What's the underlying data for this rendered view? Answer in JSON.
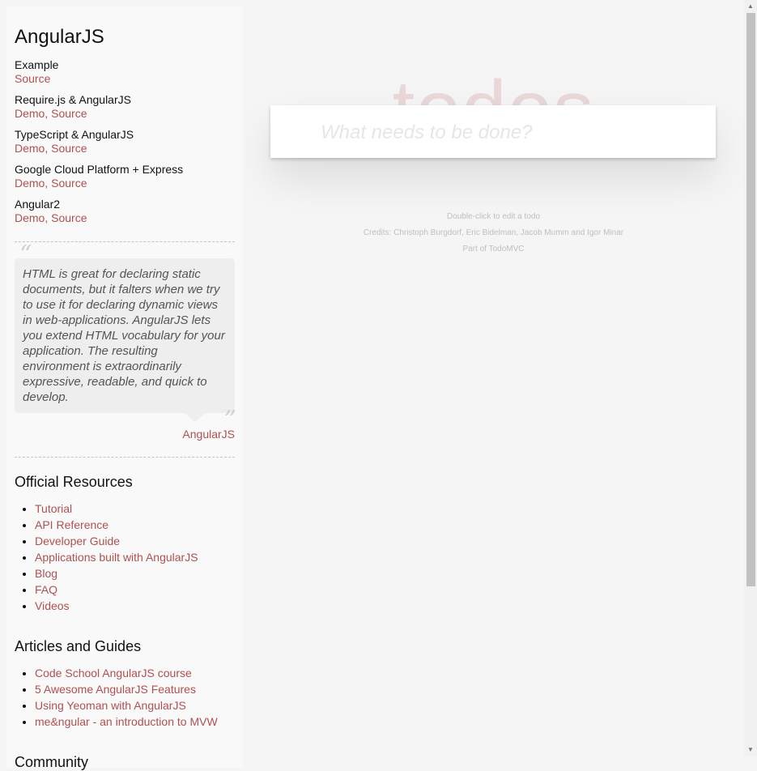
{
  "sidebar": {
    "title": "AngularJS",
    "examples": [
      {
        "name": "Example",
        "links": [
          "Source"
        ]
      },
      {
        "name": "Require.js & AngularJS",
        "links": [
          "Demo",
          "Source"
        ]
      },
      {
        "name": "TypeScript & AngularJS",
        "links": [
          "Demo",
          "Source"
        ]
      },
      {
        "name": "Google Cloud Platform + Express",
        "links": [
          "Demo",
          "Source"
        ]
      },
      {
        "name": "Angular2",
        "links": [
          "Demo",
          "Source"
        ]
      }
    ],
    "quote": {
      "text": "HTML is great for declaring static documents, but it falters when we try to use it for declaring dynamic views in web-applications. AngularJS lets you extend HTML vocabulary for your application. The resulting environment is extraordinarily expressive, readable, and quick to develop.",
      "author": "AngularJS"
    },
    "official_resources": {
      "heading": "Official Resources",
      "items": [
        "Tutorial",
        "API Reference",
        "Developer Guide",
        "Applications built with AngularJS",
        "Blog",
        "FAQ",
        "Videos"
      ]
    },
    "articles": {
      "heading": "Articles and Guides",
      "items": [
        "Code School AngularJS course",
        "5 Awesome AngularJS Features",
        "Using Yeoman with AngularJS",
        "me&ngular - an introduction to MVW"
      ]
    },
    "community": {
      "heading": "Community"
    }
  },
  "app": {
    "title": "todos",
    "new_todo_placeholder": "What needs to be done?"
  },
  "info": {
    "hint": "Double-click to edit a todo",
    "credits": "Credits: Christoph Burgdorf, Eric Bidelman, Jacob Mumm and Igor Minar",
    "part_of": "Part of TodoMVC"
  }
}
